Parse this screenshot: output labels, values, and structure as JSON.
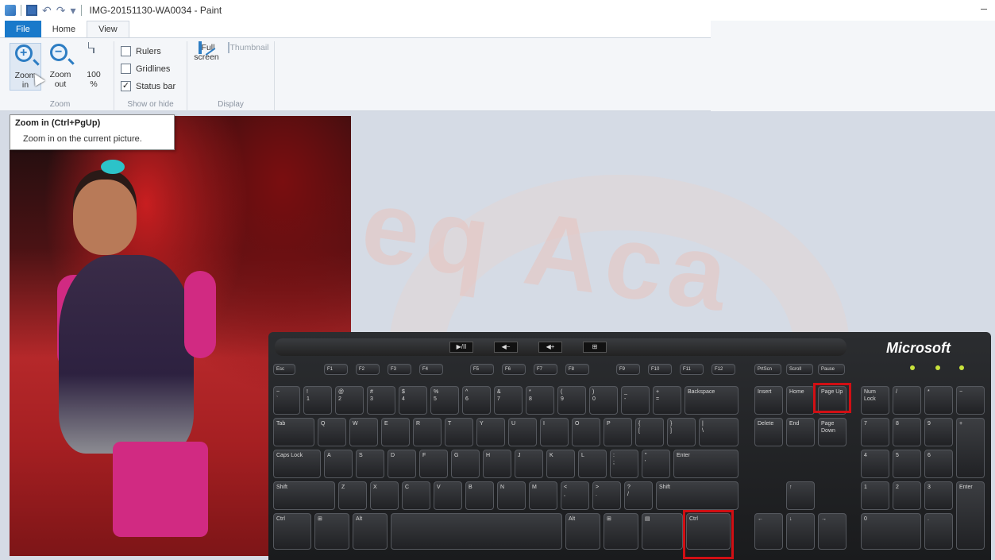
{
  "app": {
    "title": "IMG-20151130-WA0034 - Paint"
  },
  "tabs": [
    {
      "label": "File",
      "kind": "file"
    },
    {
      "label": "Home",
      "kind": "normal"
    },
    {
      "label": "View",
      "kind": "active"
    }
  ],
  "ribbon": {
    "zoom_group": {
      "label": "Zoom",
      "zoom_in": {
        "line1": "Zoom",
        "line2": "in"
      },
      "zoom_out": {
        "line1": "Zoom",
        "line2": "out"
      },
      "hundred": {
        "line1": "100",
        "line2": "%"
      }
    },
    "show_hide_group": {
      "label": "Show or hide",
      "rulers": {
        "label": "Rulers",
        "checked": false
      },
      "gridlines": {
        "label": "Gridlines",
        "checked": false
      },
      "status_bar": {
        "label": "Status bar",
        "checked": true,
        "mark": "✓"
      }
    },
    "display_group": {
      "label": "Display",
      "full_screen": {
        "line1": "Full",
        "line2": "screen"
      },
      "thumbnail": {
        "line1": "Thumbnail"
      }
    }
  },
  "tooltip": {
    "title": "Zoom in (Ctrl+PgUp)",
    "description": "Zoom in on the current picture."
  },
  "keyboard": {
    "brand": "Microsoft",
    "highlighted_keys": [
      "Page Up",
      "Ctrl"
    ],
    "keys": {
      "backspace": "Backspace",
      "tab": "Tab",
      "caps": "Caps Lock",
      "enter": "Enter",
      "shift_l": "Shift",
      "shift_r": "Shift",
      "ctrl_l": "Ctrl",
      "alt_l": "Alt",
      "alt_r": "Alt",
      "ctrl_r": "Ctrl",
      "insert": "Insert",
      "home": "Home",
      "pgup": "Page Up",
      "delete": "Delete",
      "end": "End",
      "pgdn": "Page Down",
      "numlock": "Num Lock",
      "esc": "Esc",
      "prtsc": "PrtScn",
      "scroll": "Scroll",
      "pause": "Pause"
    }
  },
  "colors": {
    "file_tab": "#1979ca",
    "highlight": "#d10f14",
    "ribbon_bg": "#f4f6f9"
  }
}
